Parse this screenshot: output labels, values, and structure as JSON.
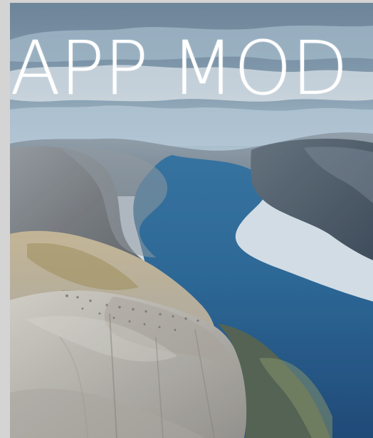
{
  "app": {
    "title": "APP MOD"
  },
  "hero": {
    "image_description_icon": "landscape-photo-icon"
  },
  "colors": {
    "background": "#d4d4d4",
    "sky": "#8fb1c7",
    "water": "#1c5d8e",
    "rock": "#b9b3a8"
  }
}
